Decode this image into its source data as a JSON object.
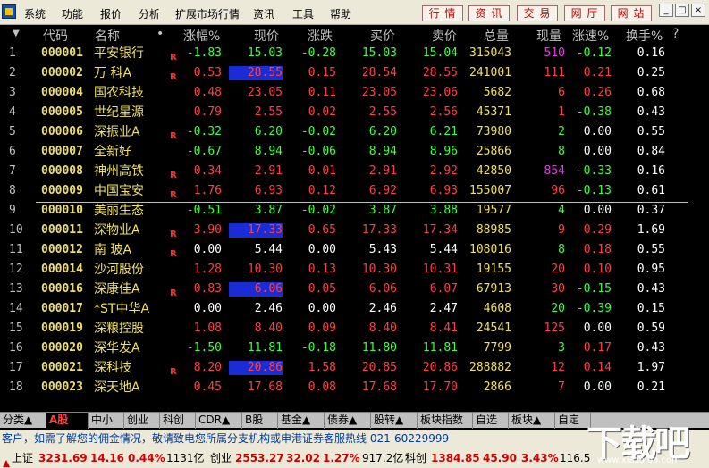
{
  "menubar": {
    "items": [
      "系统",
      "功能",
      "报价",
      "分析",
      "扩展市场行情",
      "资讯",
      "工具",
      "帮助"
    ],
    "quick_buttons": [
      "行 情",
      "资 讯",
      "交 易",
      "网 厅",
      "网 站"
    ],
    "window_controls": [
      "_",
      "□",
      "×"
    ]
  },
  "table": {
    "headers": {
      "sort": "▼",
      "code": "代码",
      "name": "名称",
      "dot": "•",
      "pct": "涨幅%",
      "price": "现价",
      "change": "涨跌",
      "bid": "买价",
      "ask": "卖价",
      "volume": "总量",
      "now": "现量",
      "speed": "涨速%",
      "turnover": "换手%",
      "help": "?"
    },
    "rows": [
      {
        "idx": "1",
        "code": "000001",
        "name": "平安银行",
        "flag": "R",
        "pct": "-1.83",
        "price": "15.03",
        "change": "-0.28",
        "bid": "15.03",
        "ask": "15.04",
        "volume": "315043",
        "now": "510",
        "speed": "-0.12",
        "turnover": "0.16"
      },
      {
        "idx": "2",
        "code": "000002",
        "name": "万 科A",
        "flag": "R",
        "pct": "0.53",
        "price": "28.55",
        "change": "0.15",
        "bid": "28.54",
        "ask": "28.55",
        "volume": "241001",
        "now": "111",
        "speed": "0.21",
        "turnover": "0.25"
      },
      {
        "idx": "3",
        "code": "000004",
        "name": "国农科技",
        "flag": "",
        "pct": "0.48",
        "price": "23.05",
        "change": "0.11",
        "bid": "23.05",
        "ask": "23.06",
        "volume": "5682",
        "now": "6",
        "speed": "0.26",
        "turnover": "0.68"
      },
      {
        "idx": "4",
        "code": "000005",
        "name": "世纪星源",
        "flag": "",
        "pct": "0.79",
        "price": "2.55",
        "change": "0.02",
        "bid": "2.55",
        "ask": "2.56",
        "volume": "45371",
        "now": "1",
        "speed": "-0.38",
        "turnover": "0.43"
      },
      {
        "idx": "5",
        "code": "000006",
        "name": "深振业A",
        "flag": "R",
        "pct": "-0.32",
        "price": "6.20",
        "change": "-0.02",
        "bid": "6.20",
        "ask": "6.21",
        "volume": "73980",
        "now": "2",
        "speed": "0.00",
        "turnover": "0.55"
      },
      {
        "idx": "6",
        "code": "000007",
        "name": "全新好",
        "flag": "",
        "pct": "-0.67",
        "price": "8.94",
        "change": "-0.06",
        "bid": "8.94",
        "ask": "8.96",
        "volume": "25866",
        "now": "8",
        "speed": "0.00",
        "turnover": "0.84"
      },
      {
        "idx": "7",
        "code": "000008",
        "name": "神州高铁",
        "flag": "R",
        "pct": "0.34",
        "price": "2.91",
        "change": "0.01",
        "bid": "2.91",
        "ask": "2.92",
        "volume": "42850",
        "now": "854",
        "speed": "-0.33",
        "turnover": "0.16"
      },
      {
        "idx": "8",
        "code": "000009",
        "name": "中国宝安",
        "flag": "R",
        "pct": "1.76",
        "price": "6.93",
        "change": "0.12",
        "bid": "6.92",
        "ask": "6.93",
        "volume": "155007",
        "now": "96",
        "speed": "-0.13",
        "turnover": "0.61"
      },
      {
        "idx": "9",
        "code": "000010",
        "name": "美丽生态",
        "flag": "",
        "pct": "-0.51",
        "price": "3.87",
        "change": "-0.02",
        "bid": "3.87",
        "ask": "3.88",
        "volume": "19577",
        "now": "4",
        "speed": "0.00",
        "turnover": "0.37"
      },
      {
        "idx": "10",
        "code": "000011",
        "name": "深物业A",
        "flag": "R",
        "pct": "3.90",
        "price": "17.33",
        "change": "0.65",
        "bid": "17.33",
        "ask": "17.34",
        "volume": "88985",
        "now": "9",
        "speed": "0.29",
        "turnover": "1.69"
      },
      {
        "idx": "11",
        "code": "000012",
        "name": "南 玻A",
        "flag": "R",
        "pct": "0.00",
        "price": "5.44",
        "change": "0.00",
        "bid": "5.43",
        "ask": "5.44",
        "volume": "108016",
        "now": "8",
        "speed": "0.18",
        "turnover": "0.55"
      },
      {
        "idx": "12",
        "code": "000014",
        "name": "沙河股份",
        "flag": "",
        "pct": "1.28",
        "price": "10.30",
        "change": "0.13",
        "bid": "10.30",
        "ask": "10.31",
        "volume": "19155",
        "now": "20",
        "speed": "0.10",
        "turnover": "0.95"
      },
      {
        "idx": "13",
        "code": "000016",
        "name": "深康佳A",
        "flag": "R",
        "pct": "0.83",
        "price": "6.06",
        "change": "0.05",
        "bid": "6.06",
        "ask": "6.07",
        "volume": "67913",
        "now": "30",
        "speed": "-0.15",
        "turnover": "0.43"
      },
      {
        "idx": "14",
        "code": "000017",
        "name": "*ST中华A",
        "flag": "",
        "pct": "0.00",
        "price": "2.46",
        "change": "0.00",
        "bid": "2.46",
        "ask": "2.47",
        "volume": "4608",
        "now": "20",
        "speed": "-0.39",
        "turnover": "0.15"
      },
      {
        "idx": "15",
        "code": "000019",
        "name": "深粮控股",
        "flag": "",
        "pct": "1.08",
        "price": "8.40",
        "change": "0.09",
        "bid": "8.40",
        "ask": "8.41",
        "volume": "24541",
        "now": "125",
        "speed": "0.00",
        "turnover": "0.59"
      },
      {
        "idx": "16",
        "code": "000020",
        "name": "深华发A",
        "flag": "",
        "pct": "-1.50",
        "price": "11.81",
        "change": "-0.18",
        "bid": "11.80",
        "ask": "11.81",
        "volume": "7799",
        "now": "3",
        "speed": "0.17",
        "turnover": "0.43"
      },
      {
        "idx": "17",
        "code": "000021",
        "name": "深科技",
        "flag": "R",
        "pct": "8.20",
        "price": "20.86",
        "change": "1.58",
        "bid": "20.85",
        "ask": "20.86",
        "volume": "288882",
        "now": "12",
        "speed": "0.14",
        "turnover": "1.97"
      },
      {
        "idx": "18",
        "code": "000023",
        "name": "深天地A",
        "flag": "",
        "pct": "0.45",
        "price": "17.68",
        "change": "0.08",
        "bid": "17.68",
        "ask": "17.70",
        "volume": "2866",
        "now": "7",
        "speed": "0.00",
        "turnover": "0.21"
      }
    ]
  },
  "tabs": [
    "分类▲",
    "A股",
    "中小",
    "创业",
    "科创",
    "CDR▲",
    "B股",
    "基金▲",
    "债券▲",
    "股转▲",
    "板块指数",
    "自选",
    "板块▲",
    "自定"
  ],
  "notice": "客户，如需了解您的佣金情况，敬请致电您所属分支机构或申港证券客服热线  021-60229999",
  "status": {
    "sh_label": "上证",
    "sh_value": "3231.69",
    "sh_change": "14.16",
    "sh_pct": "0.44%",
    "sh_amount": "1131亿",
    "cy_label": "创业",
    "cy_value": "2553.27",
    "cy_change": "32.02",
    "cy_pct": "1.27%",
    "cy_amount": "917.2亿",
    "kc_label": "科创",
    "kc_value": "1384.85",
    "kc_change": "45.90",
    "kc_pct": "3.43%",
    "kc_amount": "116.5"
  },
  "watermark": {
    "main": "下载吧",
    "sub": "www.xiazaiba.com"
  }
}
